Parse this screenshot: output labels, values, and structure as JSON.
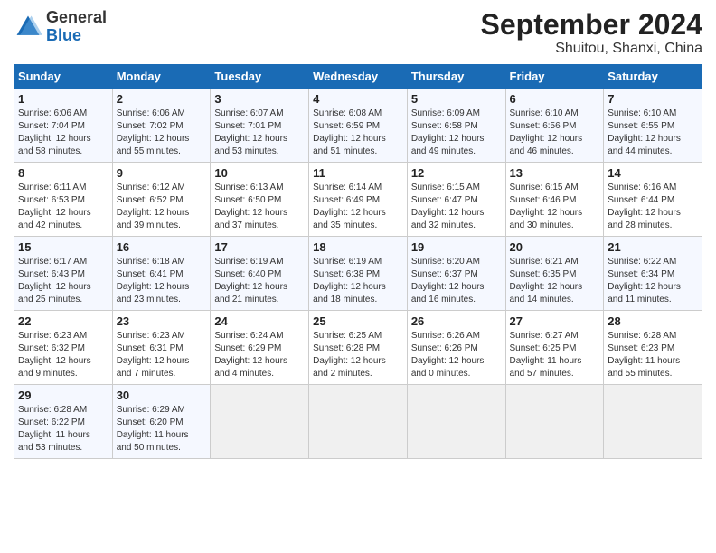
{
  "logo": {
    "general": "General",
    "blue": "Blue"
  },
  "title": "September 2024",
  "location": "Shuitou, Shanxi, China",
  "days_header": [
    "Sunday",
    "Monday",
    "Tuesday",
    "Wednesday",
    "Thursday",
    "Friday",
    "Saturday"
  ],
  "weeks": [
    [
      {
        "day": "1",
        "info": "Sunrise: 6:06 AM\nSunset: 7:04 PM\nDaylight: 12 hours\nand 58 minutes."
      },
      {
        "day": "2",
        "info": "Sunrise: 6:06 AM\nSunset: 7:02 PM\nDaylight: 12 hours\nand 55 minutes."
      },
      {
        "day": "3",
        "info": "Sunrise: 6:07 AM\nSunset: 7:01 PM\nDaylight: 12 hours\nand 53 minutes."
      },
      {
        "day": "4",
        "info": "Sunrise: 6:08 AM\nSunset: 6:59 PM\nDaylight: 12 hours\nand 51 minutes."
      },
      {
        "day": "5",
        "info": "Sunrise: 6:09 AM\nSunset: 6:58 PM\nDaylight: 12 hours\nand 49 minutes."
      },
      {
        "day": "6",
        "info": "Sunrise: 6:10 AM\nSunset: 6:56 PM\nDaylight: 12 hours\nand 46 minutes."
      },
      {
        "day": "7",
        "info": "Sunrise: 6:10 AM\nSunset: 6:55 PM\nDaylight: 12 hours\nand 44 minutes."
      }
    ],
    [
      {
        "day": "8",
        "info": "Sunrise: 6:11 AM\nSunset: 6:53 PM\nDaylight: 12 hours\nand 42 minutes."
      },
      {
        "day": "9",
        "info": "Sunrise: 6:12 AM\nSunset: 6:52 PM\nDaylight: 12 hours\nand 39 minutes."
      },
      {
        "day": "10",
        "info": "Sunrise: 6:13 AM\nSunset: 6:50 PM\nDaylight: 12 hours\nand 37 minutes."
      },
      {
        "day": "11",
        "info": "Sunrise: 6:14 AM\nSunset: 6:49 PM\nDaylight: 12 hours\nand 35 minutes."
      },
      {
        "day": "12",
        "info": "Sunrise: 6:15 AM\nSunset: 6:47 PM\nDaylight: 12 hours\nand 32 minutes."
      },
      {
        "day": "13",
        "info": "Sunrise: 6:15 AM\nSunset: 6:46 PM\nDaylight: 12 hours\nand 30 minutes."
      },
      {
        "day": "14",
        "info": "Sunrise: 6:16 AM\nSunset: 6:44 PM\nDaylight: 12 hours\nand 28 minutes."
      }
    ],
    [
      {
        "day": "15",
        "info": "Sunrise: 6:17 AM\nSunset: 6:43 PM\nDaylight: 12 hours\nand 25 minutes."
      },
      {
        "day": "16",
        "info": "Sunrise: 6:18 AM\nSunset: 6:41 PM\nDaylight: 12 hours\nand 23 minutes."
      },
      {
        "day": "17",
        "info": "Sunrise: 6:19 AM\nSunset: 6:40 PM\nDaylight: 12 hours\nand 21 minutes."
      },
      {
        "day": "18",
        "info": "Sunrise: 6:19 AM\nSunset: 6:38 PM\nDaylight: 12 hours\nand 18 minutes."
      },
      {
        "day": "19",
        "info": "Sunrise: 6:20 AM\nSunset: 6:37 PM\nDaylight: 12 hours\nand 16 minutes."
      },
      {
        "day": "20",
        "info": "Sunrise: 6:21 AM\nSunset: 6:35 PM\nDaylight: 12 hours\nand 14 minutes."
      },
      {
        "day": "21",
        "info": "Sunrise: 6:22 AM\nSunset: 6:34 PM\nDaylight: 12 hours\nand 11 minutes."
      }
    ],
    [
      {
        "day": "22",
        "info": "Sunrise: 6:23 AM\nSunset: 6:32 PM\nDaylight: 12 hours\nand 9 minutes."
      },
      {
        "day": "23",
        "info": "Sunrise: 6:23 AM\nSunset: 6:31 PM\nDaylight: 12 hours\nand 7 minutes."
      },
      {
        "day": "24",
        "info": "Sunrise: 6:24 AM\nSunset: 6:29 PM\nDaylight: 12 hours\nand 4 minutes."
      },
      {
        "day": "25",
        "info": "Sunrise: 6:25 AM\nSunset: 6:28 PM\nDaylight: 12 hours\nand 2 minutes."
      },
      {
        "day": "26",
        "info": "Sunrise: 6:26 AM\nSunset: 6:26 PM\nDaylight: 12 hours\nand 0 minutes."
      },
      {
        "day": "27",
        "info": "Sunrise: 6:27 AM\nSunset: 6:25 PM\nDaylight: 11 hours\nand 57 minutes."
      },
      {
        "day": "28",
        "info": "Sunrise: 6:28 AM\nSunset: 6:23 PM\nDaylight: 11 hours\nand 55 minutes."
      }
    ],
    [
      {
        "day": "29",
        "info": "Sunrise: 6:28 AM\nSunset: 6:22 PM\nDaylight: 11 hours\nand 53 minutes."
      },
      {
        "day": "30",
        "info": "Sunrise: 6:29 AM\nSunset: 6:20 PM\nDaylight: 11 hours\nand 50 minutes."
      },
      {
        "day": "",
        "info": ""
      },
      {
        "day": "",
        "info": ""
      },
      {
        "day": "",
        "info": ""
      },
      {
        "day": "",
        "info": ""
      },
      {
        "day": "",
        "info": ""
      }
    ]
  ]
}
